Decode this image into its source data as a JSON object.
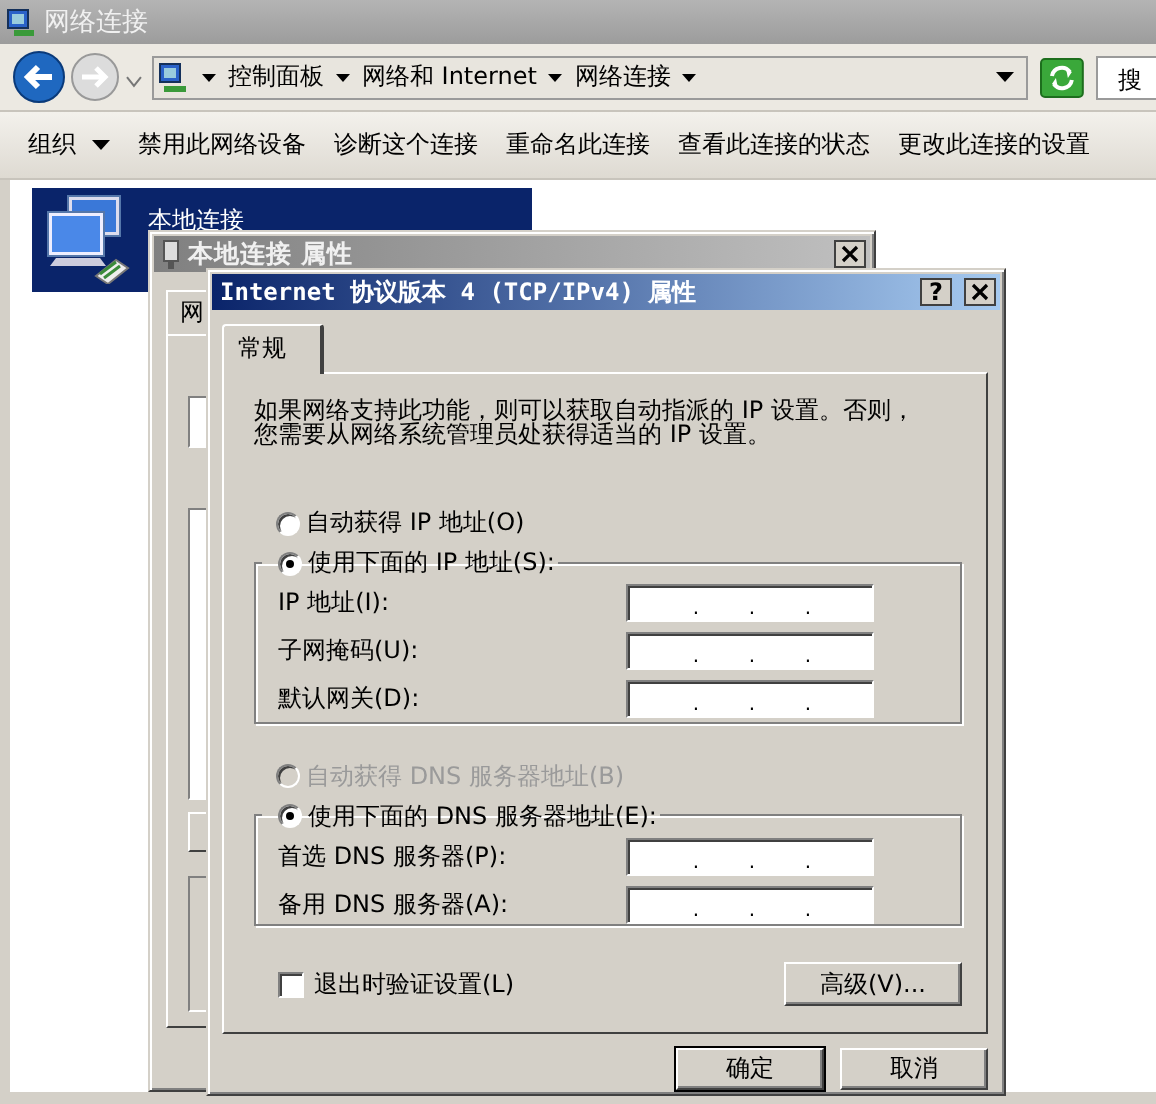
{
  "explorer": {
    "title": "网络连接",
    "breadcrumb": [
      {
        "label": "控制面板"
      },
      {
        "label": "网络和 Internet"
      },
      {
        "label": "网络连接"
      }
    ],
    "search": {
      "placeholder": "搜"
    },
    "toolbar": [
      {
        "label": "组织",
        "kind": "menu"
      },
      {
        "label": "禁用此网络设备",
        "kind": "command"
      },
      {
        "label": "诊断这个连接",
        "kind": "command"
      },
      {
        "label": "重命名此连接",
        "kind": "command"
      },
      {
        "label": "查看此连接的状态",
        "kind": "command"
      },
      {
        "label": "更改此连接的设置",
        "kind": "command"
      }
    ],
    "connections": [
      {
        "name": "本地连接",
        "selected": true
      }
    ]
  },
  "properties_window": {
    "title": "本地连接 属性",
    "tabs": [
      {
        "label": "网",
        "selected": true
      }
    ]
  },
  "ipv4_dialog": {
    "title": "Internet 协议版本 4 (TCP/IPv4) 属性",
    "help_label": "?",
    "tabs": [
      {
        "label": "常规",
        "selected": true
      }
    ],
    "description": [
      "如果网络支持此功能，则可以获取自动指派的 IP 设置。否则，",
      "您需要从网络系统管理员处获得适当的 IP 设置。"
    ],
    "ip_options": [
      {
        "label": "自动获得 IP 地址(O)",
        "selected": false,
        "disabled": false
      },
      {
        "label": "使用下面的 IP 地址(S):",
        "selected": true,
        "disabled": false
      }
    ],
    "ip_fields": [
      {
        "label": "IP 地址(I):",
        "separators": [
          ".",
          ".",
          "."
        ]
      },
      {
        "label": "子网掩码(U):",
        "separators": [
          ".",
          ".",
          "."
        ]
      },
      {
        "label": "默认网关(D):",
        "separators": [
          ".",
          ".",
          "."
        ]
      }
    ],
    "dns_options": [
      {
        "label": "自动获得 DNS 服务器地址(B)",
        "selected": false,
        "disabled": true
      },
      {
        "label": "使用下面的 DNS 服务器地址(E):",
        "selected": true,
        "disabled": false
      }
    ],
    "dns_fields": [
      {
        "label": "首选 DNS 服务器(P):",
        "separators": [
          ".",
          ".",
          "."
        ]
      },
      {
        "label": "备用 DNS 服务器(A):",
        "separators": [
          ".",
          ".",
          "."
        ]
      }
    ],
    "validate_on_exit": {
      "label": "退出时验证设置(L)",
      "checked": false
    },
    "advanced_button": "高级(V)...",
    "buttons": [
      {
        "label": "确定",
        "default": true
      },
      {
        "label": "取消",
        "default": false
      }
    ]
  }
}
